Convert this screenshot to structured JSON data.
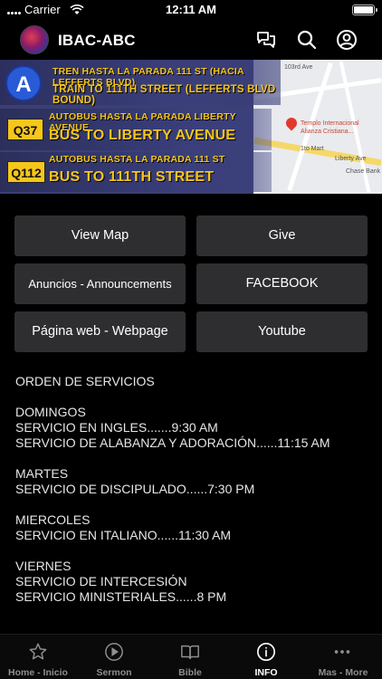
{
  "status_bar": {
    "carrier": "Carrier",
    "time": "12:11 AM"
  },
  "header": {
    "title": "IBAC-ABC",
    "icons": [
      "chat-bubbles-icon",
      "search-icon",
      "user-profile-icon"
    ]
  },
  "banner": {
    "train_line": "A",
    "train_line_es": "TREN HASTA LA PARADA 111 ST (HACIA LEFFERTS BLVD)",
    "train_line_en": "TRAIN TO 111TH STREET (LEFFERTS BLVD BOUND)",
    "bus1_route": "Q37",
    "bus1_es": "AUTOBUS HASTA LA PARADA LIBERTY AVENUE",
    "bus1_en": "BUS TO LIBERTY AVENUE",
    "bus2_route": "Q112",
    "bus2_es": "AUTOBUS HASTA LA PARADA 111 ST",
    "bus2_en": "BUS TO 111TH STREET",
    "map_labels": {
      "street_top": "103rd Ave",
      "place_name": "Templo Internacional Alianza Cristiana...",
      "street_mid": "Liberty Ave",
      "bank": "Chase Bank",
      "shop": "1to Mart"
    }
  },
  "buttons": {
    "view_map": "View Map",
    "give": "Give",
    "announcements": "Anuncios - Announcements",
    "facebook": "FACEBOOK",
    "webpage": "Página web -  Webpage",
    "youtube": "Youtube"
  },
  "services": {
    "heading": "ORDEN DE SERVICIOS",
    "domingos": "DOMINGOS",
    "domingo_1": "SERVICIO EN INGLES.......9:30 AM",
    "domingo_2": "SERVICIO DE ALABANZA Y ADORACIÓN......11:15 AM",
    "martes": "MARTES",
    "martes_1": "SERVICIO DE DISCIPULADO......7:30 PM",
    "miercoles": "MIERCOLES",
    "miercoles_1": "SERVICIO EN ITALIANO......11:30 AM",
    "viernes": "VIERNES",
    "viernes_1": "SERVICIO DE INTERCESIÓN",
    "viernes_2": "SERVICIO MINISTERIALES......8 PM"
  },
  "tabs": [
    {
      "label": "Home - Inicio",
      "icon": "star-icon",
      "active": false
    },
    {
      "label": "Sermon",
      "icon": "play-circle-icon",
      "active": false
    },
    {
      "label": "Bible",
      "icon": "open-book-icon",
      "active": false
    },
    {
      "label": "INFO",
      "icon": "info-icon",
      "active": true
    },
    {
      "label": "Mas - More",
      "icon": "more-dots-icon",
      "active": false
    }
  ],
  "colors": {
    "background": "#000000",
    "button_bg": "#2e2e30",
    "tab_active": "#ffffff",
    "tab_inactive": "#8e8e93",
    "banner_text": "#f6c61a"
  }
}
